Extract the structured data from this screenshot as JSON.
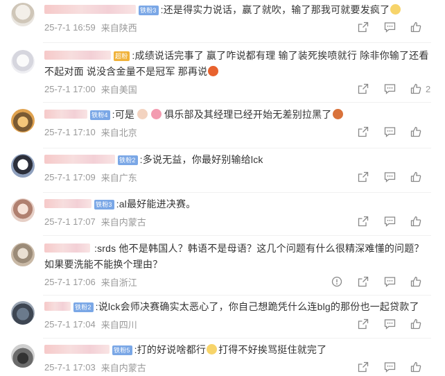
{
  "colors": {
    "badge_blue": "#7aa7e6",
    "badge_gold": "#f0b23a",
    "meta": "#999999",
    "text": "#333333"
  },
  "comments": [
    {
      "badge": "铁粉3",
      "text": ":还是得实力说话，赢了就吹，输了那我可就要发疯了",
      "date": "25-7-1 16:59",
      "loc": "来自陕西",
      "likes": ""
    },
    {
      "badge": "超粉",
      "text": ":成绩说话完事了 赢了咋说都有理 输了装死挨喷就行 除非你输了还看不起对面 说没含金量不是冠军 那再说",
      "date": "25-7-1 17:00",
      "loc": "来自美国",
      "likes": "2"
    },
    {
      "badge": "铁粉4",
      "text": ":可是",
      "text2": "俱乐部及其经理已经开始无差别拉黑了",
      "date": "25-7-1 17:10",
      "loc": "来自北京",
      "likes": ""
    },
    {
      "badge": "铁粉2",
      "text": ":多说无益，你最好别输给lck",
      "date": "25-7-1 17:09",
      "loc": "来自广东",
      "likes": ""
    },
    {
      "badge": "铁粉3",
      "text": ":al最好能进决赛。",
      "date": "25-7-1 17:07",
      "loc": "来自内蒙古",
      "likes": ""
    },
    {
      "badge": "",
      "text": ":srds 他不是韩国人？韩语不是母语？这几个问题有什么很精深难懂的问题？如果要洗能不能换个理由？",
      "date": "25-7-1 17:06",
      "loc": "来自浙江",
      "likes": ""
    },
    {
      "badge": "铁粉2",
      "text": ":说lck会师决赛确实太恶心了，你自己想跪凭什么连blg的那份也一起贷款了",
      "date": "25-7-1 17:04",
      "loc": "来自四川",
      "likes": ""
    },
    {
      "badge": "铁粉5",
      "text": ":打的好说啥都行",
      "text2": "打得不好挨骂挺住就完了",
      "date": "25-7-1 17:03",
      "loc": "来自内蒙古",
      "likes": ""
    }
  ]
}
